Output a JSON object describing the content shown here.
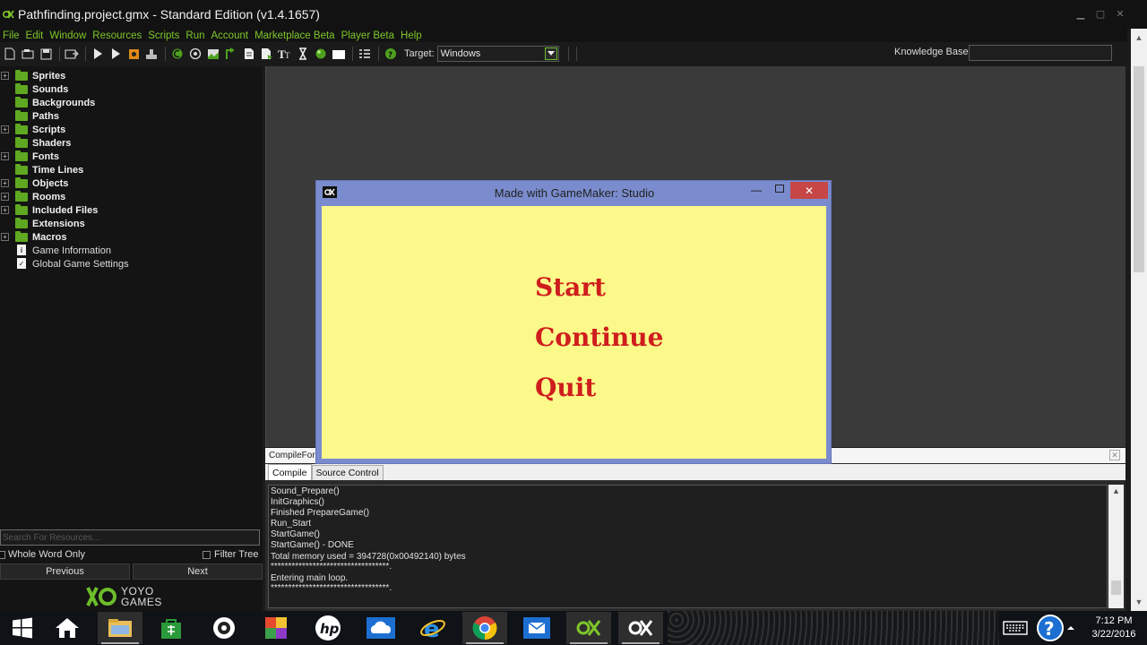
{
  "window": {
    "title": "Pathfinding.project.gmx  -  Standard Edition (v1.4.1657)",
    "controls": {
      "minimize": "▁",
      "maximize": "▢",
      "close": "✕"
    }
  },
  "menu": [
    "File",
    "Edit",
    "Window",
    "Resources",
    "Scripts",
    "Run",
    "Account",
    "Marketplace Beta",
    "Player Beta",
    "Help"
  ],
  "toolbar": {
    "target_label": "Target:",
    "target_value": "Windows",
    "knowledge_label": "Knowledge Base:",
    "knowledge_value": ""
  },
  "resource_tree": [
    {
      "label": "Sprites",
      "expandable": true,
      "kind": "folder"
    },
    {
      "label": "Sounds",
      "expandable": false,
      "kind": "folder"
    },
    {
      "label": "Backgrounds",
      "expandable": false,
      "kind": "folder"
    },
    {
      "label": "Paths",
      "expandable": false,
      "kind": "folder"
    },
    {
      "label": "Scripts",
      "expandable": true,
      "kind": "folder"
    },
    {
      "label": "Shaders",
      "expandable": false,
      "kind": "folder"
    },
    {
      "label": "Fonts",
      "expandable": true,
      "kind": "folder"
    },
    {
      "label": "Time Lines",
      "expandable": false,
      "kind": "folder"
    },
    {
      "label": "Objects",
      "expandable": true,
      "kind": "folder"
    },
    {
      "label": "Rooms",
      "expandable": true,
      "kind": "folder"
    },
    {
      "label": "Included Files",
      "expandable": true,
      "kind": "folder"
    },
    {
      "label": "Extensions",
      "expandable": false,
      "kind": "folder"
    },
    {
      "label": "Macros",
      "expandable": true,
      "kind": "folder"
    },
    {
      "label": "Game Information",
      "expandable": false,
      "kind": "doc"
    },
    {
      "label": "Global Game Settings",
      "expandable": false,
      "kind": "check"
    }
  ],
  "search": {
    "placeholder": "Search For Resources...",
    "whole_word_label": "Whole Word Only",
    "filter_tree_label": "Filter Tree",
    "previous_label": "Previous",
    "next_label": "Next"
  },
  "brand": {
    "line1": "YOYO",
    "line2": "GAMES"
  },
  "compile_panel": {
    "header": "CompileFor",
    "tabs": [
      "Compile",
      "Source Control"
    ],
    "active_tab": "Compile",
    "log": [
      "Sound_Prepare()",
      "InitGraphics()",
      "Finished PrepareGame()",
      "Run_Start",
      "StartGame()",
      "StartGame() - DONE",
      "Total memory used = 394728(0x00492140) bytes",
      "**********************************.",
      "Entering main loop.",
      "**********************************."
    ]
  },
  "game_window": {
    "title": "Made with GameMaker: Studio",
    "options": [
      "Start",
      "Continue",
      "Quit"
    ],
    "canvas_color": "#fbf98a",
    "option_color": "#cf1d1d"
  },
  "taskbar": {
    "time": "7:12 PM",
    "date": "3/22/2016",
    "apps": [
      "start",
      "home",
      "file-explorer",
      "store",
      "camera",
      "photos",
      "hp",
      "onedrive",
      "internet-explorer",
      "chrome",
      "mail",
      "gamemaker",
      "gamemaker-runner"
    ]
  },
  "colors": {
    "accent": "#7ec72a",
    "folder": "#5fa821"
  }
}
